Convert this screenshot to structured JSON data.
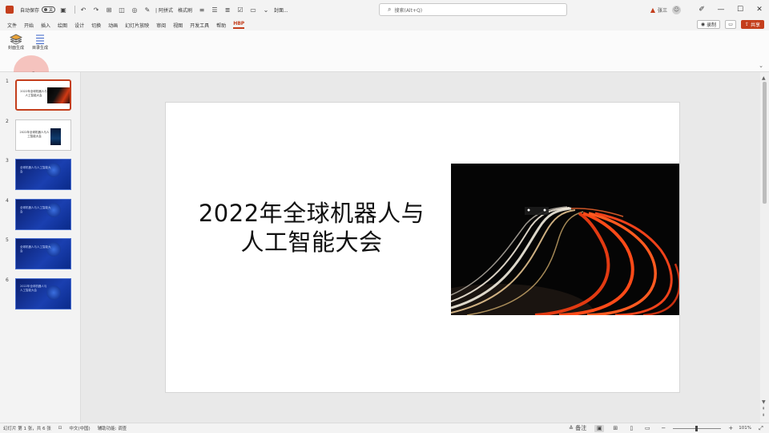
{
  "titlebar": {
    "autosave_label": "自动保存",
    "autosave_state": "关",
    "quick_text_1": "| 阿拼式",
    "quick_text_2": "格式刷",
    "quick_text_3": "封面...",
    "search_placeholder": "搜索(Alt+Q)",
    "user_name": "张三",
    "warn_icon": "warning-icon"
  },
  "tabs": {
    "items": [
      "文件",
      "开始",
      "插入",
      "绘图",
      "设计",
      "切换",
      "动画",
      "幻灯片放映",
      "审阅",
      "视图",
      "开发工具",
      "帮助",
      "HBP"
    ],
    "active": "HBP",
    "record_label": "录制",
    "share_label": "共享"
  },
  "ribbon": {
    "btn1_label": "封面生成",
    "btn2_label": "目录生成"
  },
  "thumbnails": [
    {
      "num": "1",
      "title": "2022年全球机器人与人工智能大会",
      "selected": true
    },
    {
      "num": "2",
      "title": "2022年全球机器人与人工智能大会",
      "selected": false
    },
    {
      "num": "3",
      "title": "全球机器人与人工智能大会",
      "selected": false
    },
    {
      "num": "4",
      "title": "全球机器人与人工智能大会",
      "selected": false
    },
    {
      "num": "5",
      "title": "全球机器人与人工智能大会",
      "selected": false
    },
    {
      "num": "6",
      "title": "2022年全球机器人与人工智能大会",
      "selected": false
    }
  ],
  "slide": {
    "title_line1": "2022年全球机器人与",
    "title_line2": "人工智能大会"
  },
  "status": {
    "slide_info": "幻灯片 第 1 张，共 6 张",
    "language": "中文(中国)",
    "accessibility": "辅助功能: 调查",
    "notes_label": "备注",
    "zoom": "101%"
  },
  "colors": {
    "accent": "#c43e1c"
  }
}
